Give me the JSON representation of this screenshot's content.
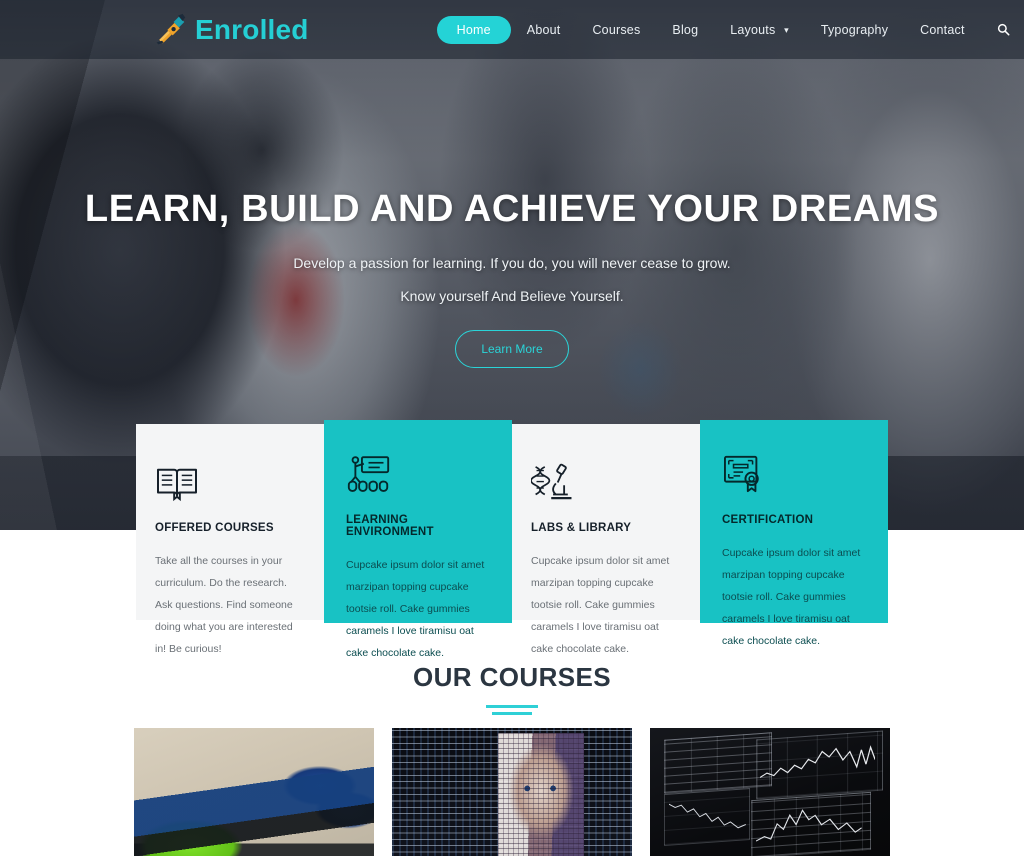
{
  "brand": {
    "name": "Enrolled",
    "logo_icon": "pen-nib-icon",
    "accent_color": "#24d3d6"
  },
  "nav": {
    "items": [
      {
        "label": "Home",
        "active": true
      },
      {
        "label": "About",
        "active": false
      },
      {
        "label": "Courses",
        "active": false
      },
      {
        "label": "Blog",
        "active": false
      },
      {
        "label": "Layouts",
        "active": false,
        "has_dropdown": true
      },
      {
        "label": "Typography",
        "active": false
      },
      {
        "label": "Contact",
        "active": false
      }
    ],
    "search_icon": "search-icon"
  },
  "hero": {
    "title": "LEARN, BUILD AND ACHIEVE YOUR DREAMS",
    "subtitle_line1": "Develop a passion for learning. If you do, you will never cease to grow.",
    "subtitle_line2": "Know yourself And Believe Yourself.",
    "cta_label": "Learn More"
  },
  "features": [
    {
      "icon": "open-book-icon",
      "title": "OFFERED COURSES",
      "text": "Take all the courses in your curriculum. Do the research. Ask questions. Find someone doing what you are interested in! Be curious!",
      "style": "light"
    },
    {
      "icon": "presentation-teacher-icon",
      "title": "LEARNING ENVIRONMENT",
      "text": "Cupcake ipsum dolor sit amet marzipan topping cupcake tootsie roll. Cake gummies caramels I love tiramisu oat cake chocolate cake.",
      "style": "teal"
    },
    {
      "icon": "microscope-dna-icon",
      "title": "LABS & LIBRARY",
      "text": "Cupcake ipsum dolor sit amet marzipan topping cupcake tootsie roll. Cake gummies caramels I love tiramisu oat cake chocolate cake.",
      "style": "light"
    },
    {
      "icon": "certificate-award-icon",
      "title": "CERTIFICATION",
      "text": "Cupcake ipsum dolor sit amet marzipan topping cupcake tootsie roll. Cake gummies caramels I love tiramisu oat cake chocolate cake.",
      "style": "teal"
    }
  ],
  "courses_section": {
    "heading": "OUR COURSES",
    "items": [
      {
        "image": "electronics-arduino-breadboard-photo"
      },
      {
        "image": "ai-code-face-photo"
      },
      {
        "image": "trading-charts-monitors-photo"
      }
    ]
  },
  "colors": {
    "teal": "#24d3d6",
    "teal_card": "#18c2c4",
    "light_card": "#f4f5f6",
    "heading_dark": "#2b3641",
    "header_overlay": "rgba(26,32,44,0.55)"
  }
}
